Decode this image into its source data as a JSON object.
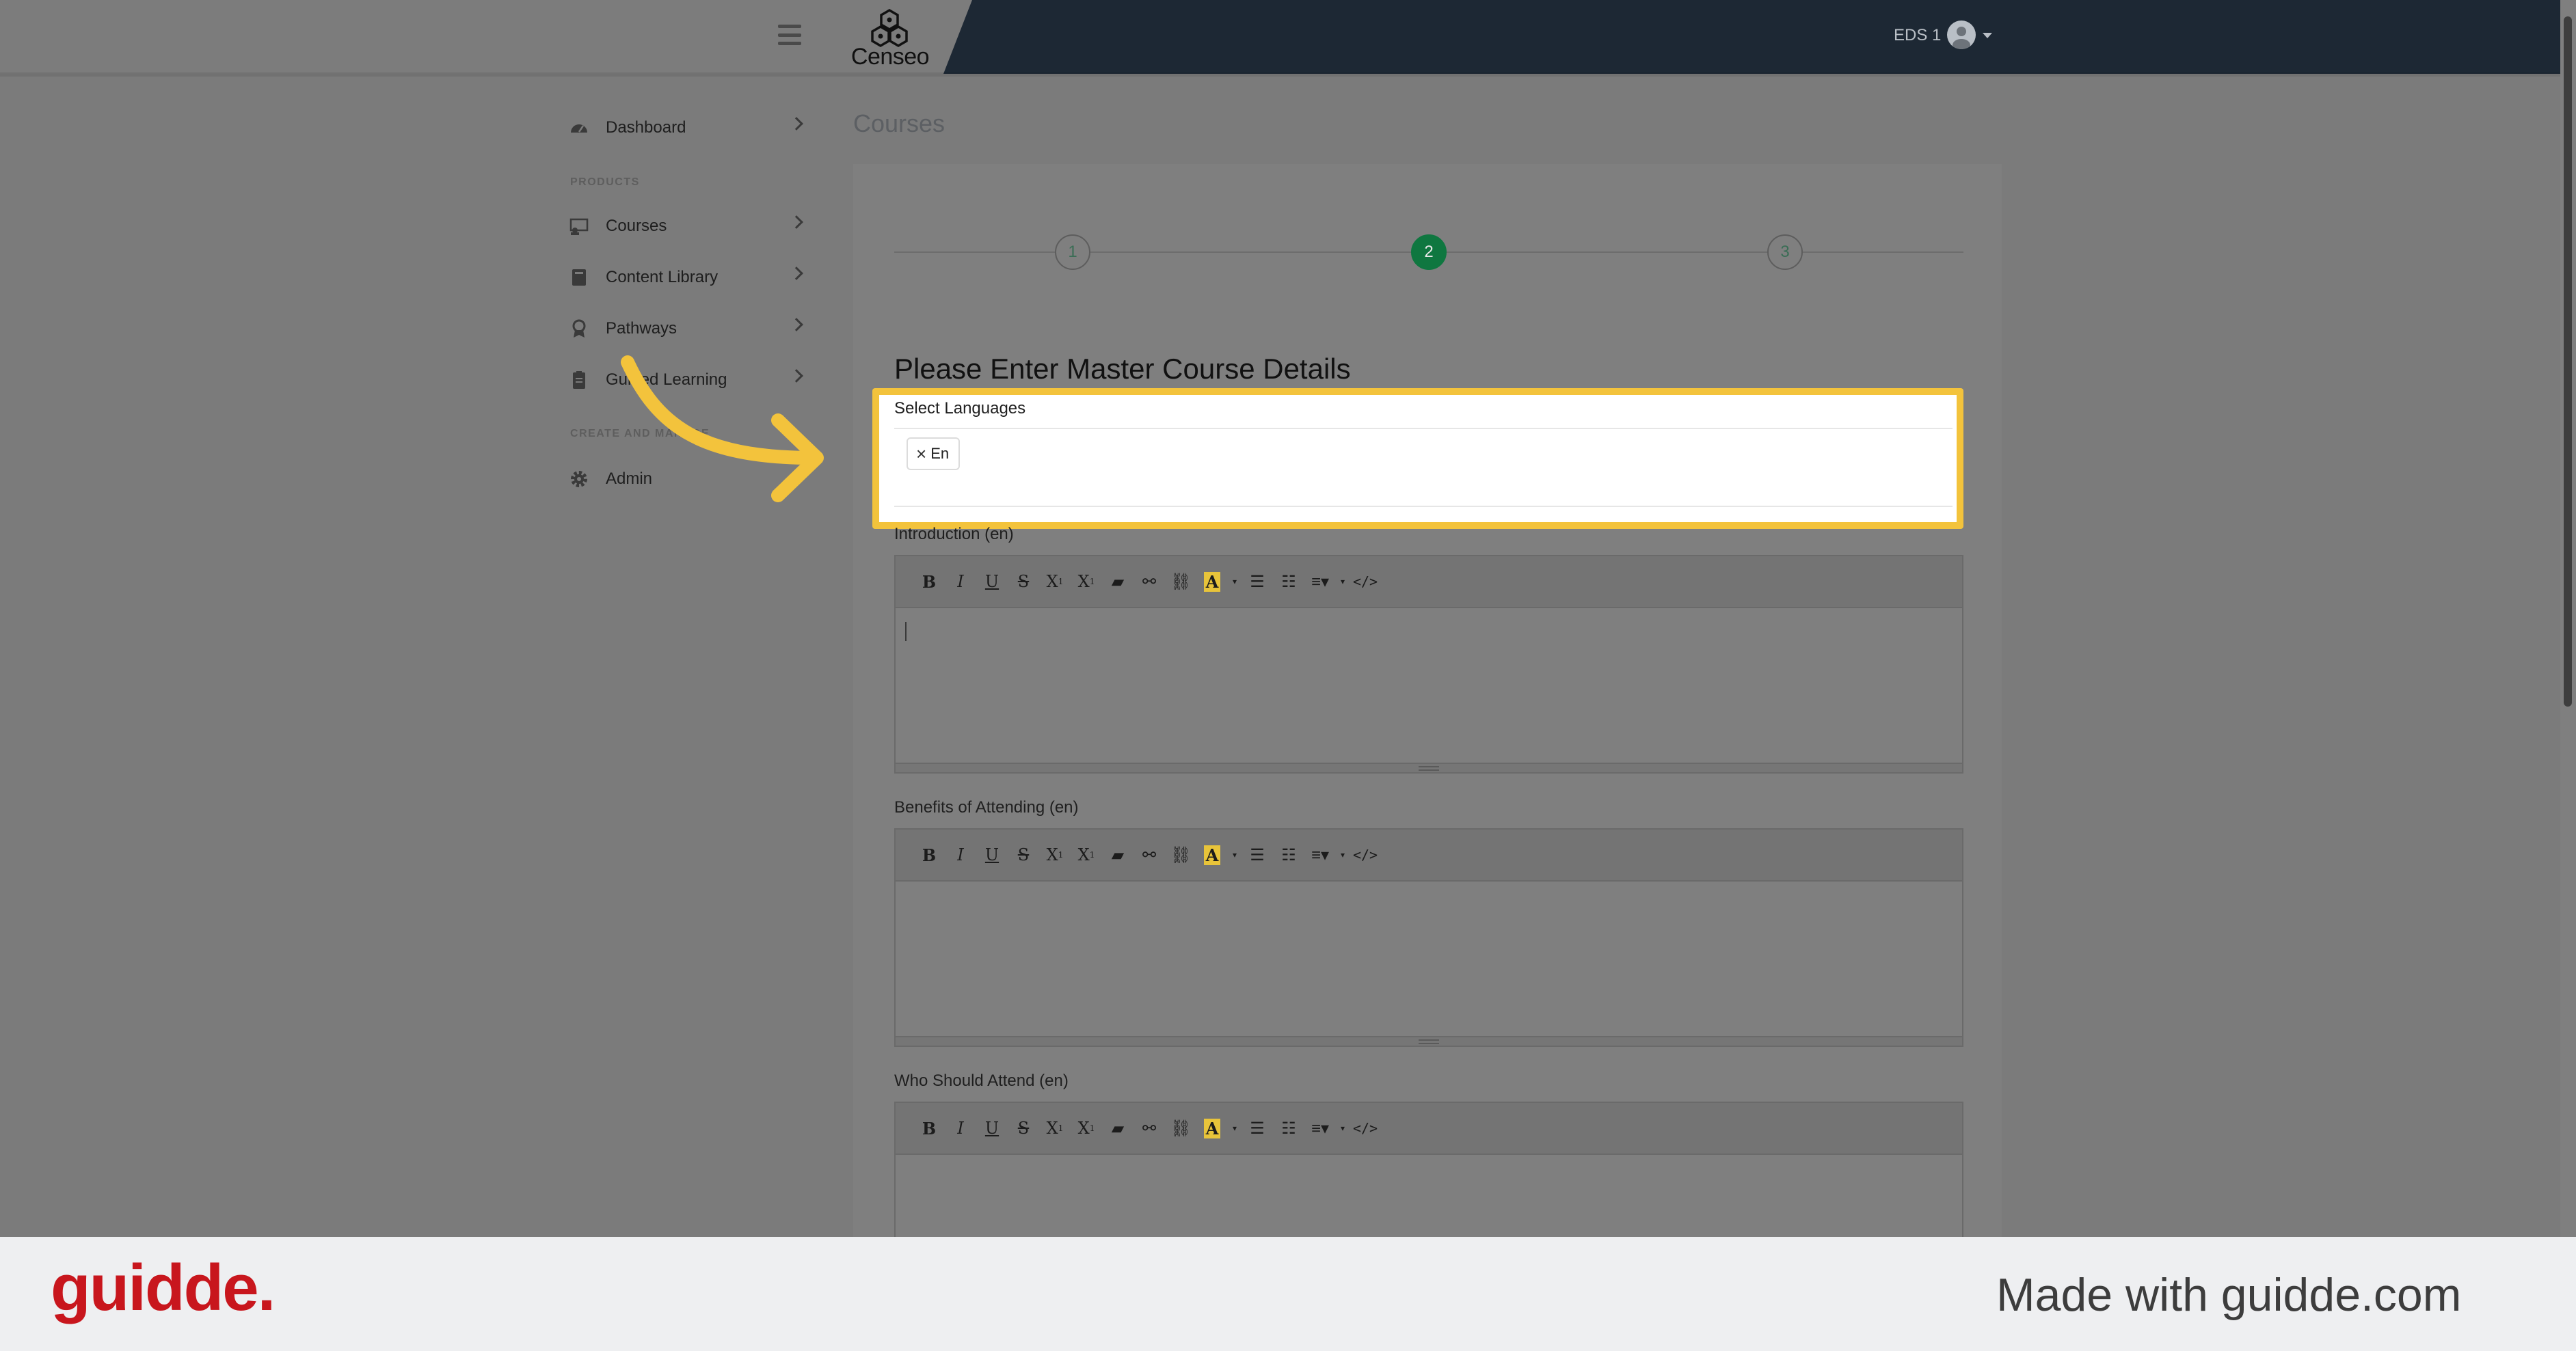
{
  "header": {
    "logo_text": "Censeo",
    "user_name": "EDS 1"
  },
  "sidebar": {
    "items_top": [
      {
        "label": "Dashboard",
        "icon": "gauge-icon"
      }
    ],
    "section_products": "PRODUCTS",
    "items_products": [
      {
        "label": "Courses",
        "icon": "courses-icon"
      },
      {
        "label": "Content Library",
        "icon": "book-icon"
      },
      {
        "label": "Pathways",
        "icon": "award-icon"
      },
      {
        "label": "Guided Learning",
        "icon": "clipboard-icon"
      }
    ],
    "section_create": "CREATE AND MANAGE",
    "items_create": [
      {
        "label": "Admin",
        "icon": "gear-icon"
      }
    ]
  },
  "main": {
    "page_title": "Courses",
    "steps": [
      "1",
      "2",
      "3"
    ],
    "active_step": 2,
    "form_heading": "Please Enter Master Course Details",
    "languages": {
      "label": "Select Languages",
      "selected": [
        "En"
      ]
    },
    "editors": [
      {
        "label": "Introduction (en)"
      },
      {
        "label": "Benefits of Attending (en)"
      },
      {
        "label": "Who Should Attend (en)"
      }
    ],
    "toolbar_icons": [
      "bold-icon",
      "italic-icon",
      "underline-icon",
      "strikethrough-icon",
      "superscript-icon",
      "subscript-icon",
      "eraser-icon",
      "link-icon",
      "unlink-icon",
      "highlight-icon",
      "bullet-list-icon",
      "numbered-list-icon",
      "align-icon",
      "code-view-icon"
    ]
  },
  "footer": {
    "brand": "guidde.",
    "tagline": "Made with guidde.com"
  },
  "colors": {
    "topbar_dark": "#1d2834",
    "active_step": "#0f7740",
    "highlight": "#f3c33c",
    "footer_brand": "#c8161d"
  }
}
